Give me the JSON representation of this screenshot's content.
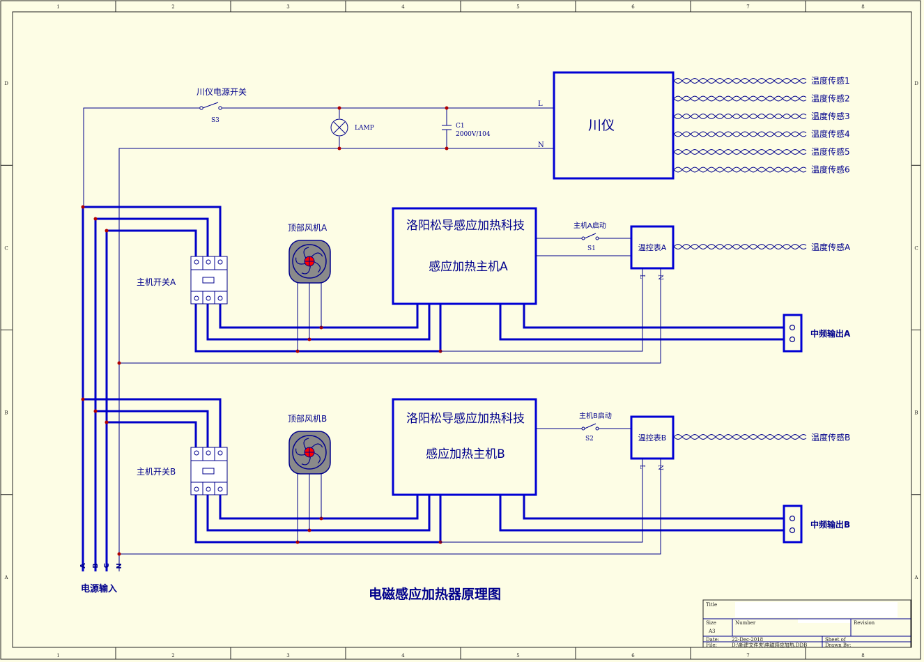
{
  "colors": {
    "paper": "#fdfde5",
    "wire": "#00008c",
    "bus": "#0000c8",
    "dot": "#b00000",
    "fan_body": "#8a8a8a",
    "fan_hub": "#ff0000"
  },
  "frame": {
    "columns": [
      "1",
      "2",
      "3",
      "4",
      "5",
      "6",
      "7",
      "8"
    ],
    "rows": [
      "D",
      "C",
      "B",
      "A"
    ]
  },
  "top": {
    "switch_label": "川仪电源开关",
    "switch_ref": "S3",
    "lamp": "LAMP",
    "cap_ref": "C1",
    "cap_val": "2000V/104",
    "l": "L",
    "n": "N",
    "meter": "川仪",
    "sensors": [
      "温度传感1",
      "温度传感2",
      "温度传感3",
      "温度传感4",
      "温度传感5",
      "温度传感6"
    ]
  },
  "unitA": {
    "host_line1": "洛阳松导感应加热科技",
    "host_line2": "感应加热主机A",
    "fan": "顶部风机A",
    "breaker": "主机开关A",
    "start": "主机A启动",
    "start_ref": "S1",
    "temp_ctrl": "温控表A",
    "sensor": "温度传感A",
    "out": "中频输出A",
    "l": "L",
    "n": "N"
  },
  "unitB": {
    "host_line1": "洛阳松导感应加热科技",
    "host_line2": "感应加热主机B",
    "fan": "顶部风机B",
    "breaker": "主机开关B",
    "start": "主机B启动",
    "start_ref": "S2",
    "temp_ctrl": "温控表B",
    "sensor": "温度传感B",
    "out": "中频输出B",
    "l": "L",
    "n": "N"
  },
  "power": {
    "phases": [
      "A",
      "B",
      "C",
      "N"
    ],
    "label": "电源输入"
  },
  "title": "电磁感应加热器原理图",
  "titleblock": {
    "title_lbl": "Title",
    "size_lbl": "Size",
    "size_val": "A3",
    "number_lbl": "Number",
    "revision_lbl": "Revision",
    "date_lbl": "Date:",
    "date_val": "22-Dec-2018",
    "sheet_lbl": "Sheet   of",
    "file_lbl": "File:",
    "file_val": "D:\\新建文件夹\\电磁感应加热.DDB",
    "drawn_lbl": "Drawn By:"
  }
}
